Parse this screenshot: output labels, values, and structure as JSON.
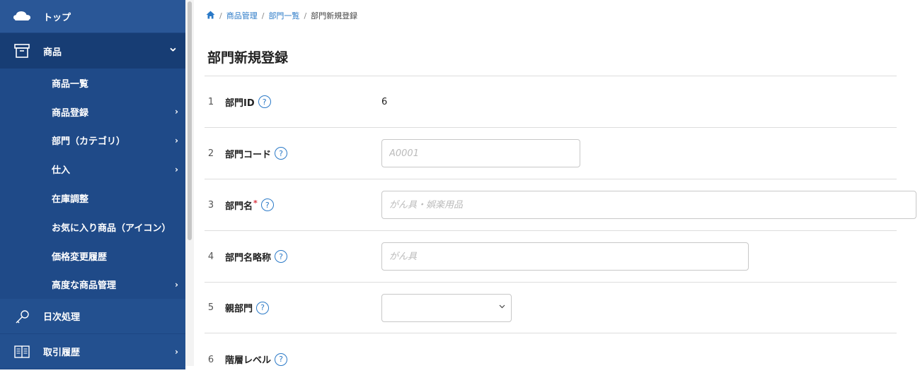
{
  "sidebar": {
    "top": {
      "label": "トップ",
      "icon": "cloud-icon"
    },
    "products": {
      "label": "商品",
      "icon": "archive-box-icon",
      "chevron": "⌄"
    },
    "sub_items": [
      {
        "label": "商品一覧",
        "chevron": ""
      },
      {
        "label": "商品登録",
        "chevron": "›"
      },
      {
        "label": "部門（カテゴリ）",
        "chevron": "›"
      },
      {
        "label": "仕入",
        "chevron": "›"
      },
      {
        "label": "在庫調整",
        "chevron": ""
      },
      {
        "label": "お気に入り商品（アイコン）",
        "chevron": ""
      },
      {
        "label": "価格変更履歴",
        "chevron": ""
      },
      {
        "label": "高度な商品管理",
        "chevron": "›"
      }
    ],
    "daily": {
      "label": "日次処理",
      "icon": "key-icon"
    },
    "history": {
      "label": "取引履歴",
      "icon": "book-icon",
      "chevron": "›"
    }
  },
  "breadcrumb": {
    "sep": "/",
    "items": [
      "商品管理",
      "部門一覧",
      "部門新規登録"
    ]
  },
  "page": {
    "title": "部門新規登録"
  },
  "form": {
    "help_symbol": "?",
    "required_mark": "*",
    "rows": [
      {
        "num": "1",
        "label": "部門ID",
        "value": "6"
      },
      {
        "num": "2",
        "label": "部門コード",
        "placeholder": "A0001"
      },
      {
        "num": "3",
        "label": "部門名",
        "placeholder": "がん具・娯楽用品"
      },
      {
        "num": "4",
        "label": "部門名略称",
        "placeholder": "がん具"
      },
      {
        "num": "5",
        "label": "親部門",
        "value": ""
      },
      {
        "num": "6",
        "label": "階層レベル"
      }
    ]
  },
  "colors": {
    "sidebar": "#23508f",
    "accent": "#2a79c7",
    "required": "#d9333f"
  }
}
